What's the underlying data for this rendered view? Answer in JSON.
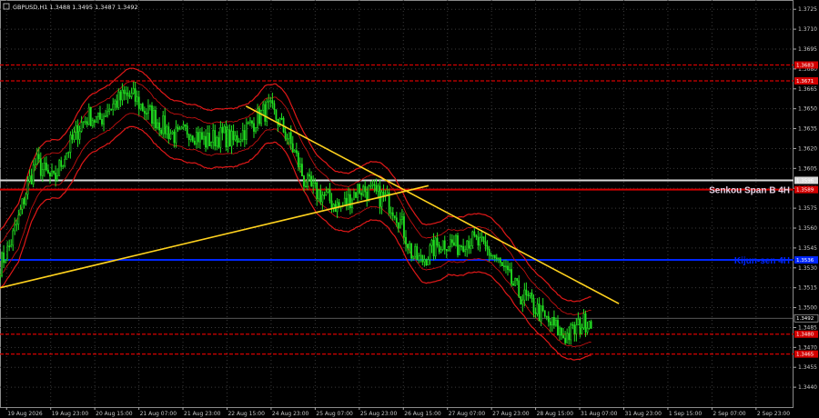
{
  "chart_data": {
    "type": "candlestick",
    "title": "GBPUSD,H1  1.3488 1.3495 1.3487 1.3492",
    "ylim": [
      1.3425,
      1.3732
    ],
    "y_ticks": [
      1.3725,
      1.371,
      1.3695,
      1.368,
      1.3665,
      1.365,
      1.3635,
      1.362,
      1.3605,
      1.359,
      1.3575,
      1.356,
      1.3545,
      1.353,
      1.3515,
      1.35,
      1.3485,
      1.347,
      1.3455,
      1.344
    ],
    "x_labels": [
      "19 Aug 2026",
      "19 Aug 23:00",
      "20 Aug 15:00",
      "21 Aug 07:00",
      "21 Aug 23:00",
      "22 Aug 15:00",
      "24 Aug 23:00",
      "25 Aug 07:00",
      "25 Aug 23:00",
      "26 Aug 15:00",
      "27 Aug 07:00",
      "27 Aug 23:00",
      "28 Aug 15:00",
      "31 Aug 07:00",
      "31 Aug 23:00",
      "1 Sep 15:00",
      "2 Sep 07:00",
      "2 Sep 23:00"
    ],
    "price_path": [
      1.3532,
      1.3545,
      1.3565,
      1.359,
      1.361,
      1.3602,
      1.3595,
      1.3612,
      1.3625,
      1.3638,
      1.3645,
      1.364,
      1.365,
      1.3655,
      1.366,
      1.3658,
      1.365,
      1.3645,
      1.3638,
      1.3632,
      1.3628,
      1.3635,
      1.363,
      1.3625,
      1.3628,
      1.363,
      1.3625,
      1.3632,
      1.3638,
      1.3645,
      1.365,
      1.3642,
      1.363,
      1.3615,
      1.3595,
      1.3588,
      1.3585,
      1.358,
      1.3575,
      1.3582,
      1.359,
      1.3588,
      1.3585,
      1.3582,
      1.3575,
      1.356,
      1.354,
      1.3535,
      1.3542,
      1.3548,
      1.355,
      1.3546,
      1.3552,
      1.355,
      1.3545,
      1.354,
      1.353,
      1.352,
      1.351,
      1.3505,
      1.3498,
      1.349,
      1.3485,
      1.3478,
      1.3482,
      1.3488,
      1.3492
    ],
    "ichimoku_band": {
      "upper_offset": 0.0012,
      "lower_offset": 0.0012
    },
    "bollinger_offset": 0.0022,
    "trendlines": [
      {
        "from": [
          0.0,
          1.3515
        ],
        "to": [
          0.54,
          1.3592
        ],
        "color": "#ffd21e"
      },
      {
        "from": [
          0.31,
          1.3652
        ],
        "to": [
          0.78,
          1.3503
        ],
        "color": "#ffd21e"
      }
    ],
    "levels": [
      {
        "price": 1.3683,
        "label": "1.3683",
        "color": "#d40000",
        "style": "dash"
      },
      {
        "price": 1.3671,
        "label": "1.3671",
        "color": "#d40000",
        "style": "dash"
      },
      {
        "price": 1.3596,
        "label": "1.3596",
        "color": "#d8d8d8",
        "style": "solid"
      },
      {
        "price": 1.3589,
        "label": "1.3589",
        "color": "#d40000",
        "style": "solid"
      },
      {
        "price": 1.3536,
        "label": "1.3536",
        "color": "#0026ff",
        "style": "solid"
      },
      {
        "price": 1.348,
        "label": "1.3480",
        "color": "#d40000",
        "style": "dash"
      },
      {
        "price": 1.3465,
        "label": "1.3465",
        "color": "#d40000",
        "style": "dash"
      }
    ],
    "last_price": {
      "price": 1.3492,
      "label": "1.3492"
    },
    "annotations": [
      {
        "text": "Senkou Span B 4H",
        "price": 1.3589,
        "color": "#e8d5e8"
      },
      {
        "text": "Kijun-sen 4H",
        "price": 1.3536,
        "color": "#0026ff"
      }
    ],
    "grid": true
  }
}
